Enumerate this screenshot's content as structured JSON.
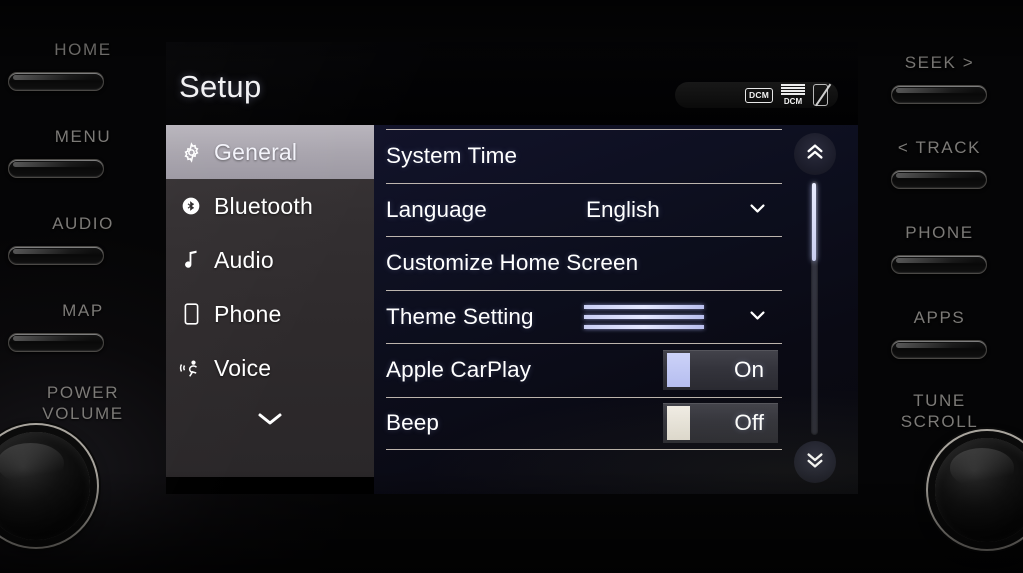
{
  "screen": {
    "title": "Setup",
    "status_bar": {
      "dcm_badge": "DCM",
      "signal_label": "DCM",
      "phone_icon": "phone-disconnected-icon"
    },
    "sidebar": {
      "items": [
        {
          "label": "General",
          "icon": "gear-icon",
          "selected": true
        },
        {
          "label": "Bluetooth",
          "icon": "bluetooth-icon",
          "selected": false
        },
        {
          "label": "Audio",
          "icon": "music-note-icon",
          "selected": false
        },
        {
          "label": "Phone",
          "icon": "phone-icon",
          "selected": false
        },
        {
          "label": "Voice",
          "icon": "voice-icon",
          "selected": false
        }
      ],
      "more_icon": "chevron-down-icon"
    },
    "settings_list": [
      {
        "label": "System Time",
        "value": "",
        "control": "none"
      },
      {
        "label": "Language",
        "value": "English",
        "control": "chevron"
      },
      {
        "label": "Customize Home Screen",
        "value": "",
        "control": "none"
      },
      {
        "label": "Theme Setting",
        "value": "",
        "control": "swatch-chevron"
      },
      {
        "label": "Apple CarPlay",
        "value": "On",
        "control": "toggle-on"
      },
      {
        "label": "Beep",
        "value": "Off",
        "control": "toggle-off"
      }
    ],
    "scroll": {
      "up_icon": "double-chevron-up-icon",
      "down_icon": "double-chevron-down-icon"
    },
    "colors": {
      "accent": "#c9cef4",
      "selected_row": "#b9b5bd",
      "divider": "#e9ded2",
      "panel_bg": "#12132a"
    }
  },
  "bezel": {
    "left_buttons": [
      {
        "label": "HOME"
      },
      {
        "label": "MENU"
      },
      {
        "label": "AUDIO"
      },
      {
        "label": "MAP"
      }
    ],
    "left_knob": {
      "line1": "POWER",
      "line2": "VOLUME"
    },
    "right_buttons": [
      {
        "label": "SEEK >"
      },
      {
        "label": "< TRACK"
      },
      {
        "label": "PHONE"
      },
      {
        "label": "APPS"
      }
    ],
    "right_knob": {
      "line1": "TUNE",
      "line2": "SCROLL"
    }
  }
}
